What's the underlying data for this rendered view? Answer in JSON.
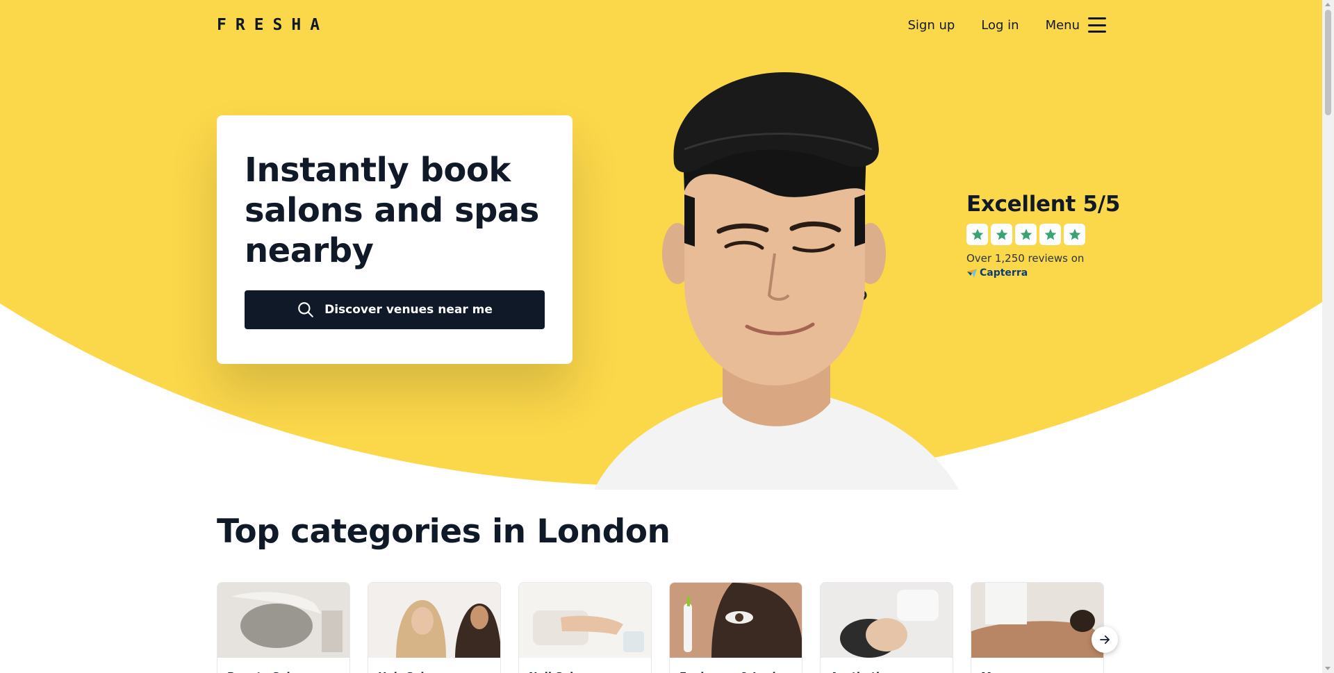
{
  "nav": {
    "logo": "FRESHA",
    "signup": "Sign up",
    "login": "Log in",
    "menu": "Menu"
  },
  "hero": {
    "title": "Instantly book salons and spas nearby",
    "button": "Discover venues near me",
    "button_icon": "search-icon"
  },
  "rating": {
    "title": "Excellent 5/5",
    "stars": 5,
    "subtitle": "Over 1,250 reviews on",
    "brand": "Capterra"
  },
  "categories": {
    "title": "Top categories in London",
    "items": [
      {
        "label": "Beauty Salons"
      },
      {
        "label": "Hair Salons"
      },
      {
        "label": "Nail Salons"
      },
      {
        "label": "Eyebrows & Lashes"
      },
      {
        "label": "Aesthetics"
      },
      {
        "label": "Massage"
      }
    ]
  },
  "colors": {
    "brand_yellow": "#fbd74a",
    "dark": "#101928",
    "star_green": "#3aa36f"
  }
}
